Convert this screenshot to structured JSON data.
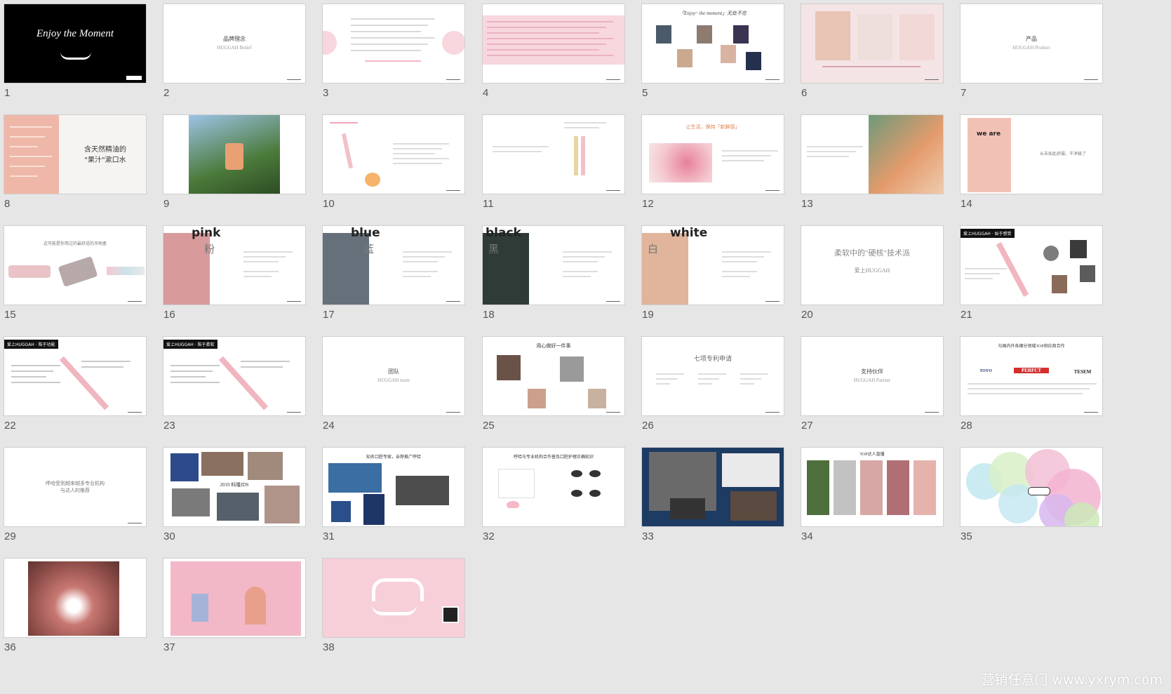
{
  "slides": [
    {
      "num": "1",
      "kind": "cover",
      "title": "Enjoy the Moment"
    },
    {
      "num": "2",
      "kind": "section",
      "title": "品牌理念",
      "subtitle": "HUGGAH Belief"
    },
    {
      "num": "3",
      "kind": "text-pink-circles"
    },
    {
      "num": "4",
      "kind": "text-pink-band"
    },
    {
      "num": "5",
      "kind": "photos-grid",
      "title": "「Enjoy~ the moment」无处不在"
    },
    {
      "num": "6",
      "kind": "photo-woman"
    },
    {
      "num": "7",
      "kind": "section",
      "title": "产品",
      "subtitle": "HUGGAH Product"
    },
    {
      "num": "8",
      "kind": "mouthwash",
      "title": "含天然精油的\n\"果汁\"漱口水"
    },
    {
      "num": "9",
      "kind": "photo-bottle"
    },
    {
      "num": "10",
      "kind": "product-detail"
    },
    {
      "num": "11",
      "kind": "product-detail-2"
    },
    {
      "num": "12",
      "kind": "flowers",
      "title": "让生活，保持「新鲜感」"
    },
    {
      "num": "13",
      "kind": "photo-right"
    },
    {
      "num": "14",
      "kind": "we-are",
      "title": "we are",
      "subtitle": "从未如此舒服，干净极了"
    },
    {
      "num": "15",
      "kind": "cases",
      "title": "这可能是你用过的最舒适的牙刷盒"
    },
    {
      "num": "16",
      "kind": "color",
      "word": "pink",
      "cn": "粉"
    },
    {
      "num": "17",
      "kind": "color",
      "word": "blue",
      "cn": "蓝"
    },
    {
      "num": "18",
      "kind": "color",
      "word": "black",
      "cn": "黑"
    },
    {
      "num": "19",
      "kind": "color",
      "word": "white",
      "cn": "白"
    },
    {
      "num": "20",
      "kind": "tech",
      "title": "柔软中的\"硬核\"技术派",
      "subtitle": "爱上HUGGAH"
    },
    {
      "num": "21",
      "kind": "designers",
      "tag": "爱上HUGGAH · 始于感受"
    },
    {
      "num": "22",
      "kind": "brush-feature",
      "tag": "爱上HUGGAH · 陷于功能"
    },
    {
      "num": "23",
      "kind": "brush-feature2",
      "tag": "爱上HUGGAH · 陷于柔软"
    },
    {
      "num": "24",
      "kind": "section",
      "title": "团队",
      "subtitle": "HUGGAH team"
    },
    {
      "num": "25",
      "kind": "team",
      "title": "用心做好一件事"
    },
    {
      "num": "26",
      "kind": "patents",
      "title": "七项专利申请"
    },
    {
      "num": "27",
      "kind": "section",
      "title": "支持伙伴",
      "subtitle": "HUGGAH Partner"
    },
    {
      "num": "28",
      "kind": "partners",
      "title": "与国内外各细分领域TOP供应商合作",
      "logos": [
        "TOYO",
        "PERFCT",
        "TESEM"
      ]
    },
    {
      "num": "29",
      "kind": "section2",
      "title": "呼哈受到越来越多专业机构\n与达人的推荐"
    },
    {
      "num": "30",
      "kind": "collage",
      "label": "2019 科隆IDS"
    },
    {
      "num": "31",
      "kind": "media",
      "title": "知名口腔专家，亲荐推广呼哈"
    },
    {
      "num": "32",
      "kind": "tips",
      "title": "呼哈与专业机构合作普及口腔护理正确知识"
    },
    {
      "num": "33",
      "kind": "navy-collage"
    },
    {
      "num": "34",
      "kind": "kols",
      "title": "TOP达人直播"
    },
    {
      "num": "35",
      "kind": "circles"
    },
    {
      "num": "36",
      "kind": "smile"
    },
    {
      "num": "37",
      "kind": "pink-scene"
    },
    {
      "num": "38",
      "kind": "end-pink"
    }
  ],
  "watermark": "营销任意门 www.yxrym.com",
  "colors": {
    "background": "#e6e6e6",
    "pink": "#f6cfd8",
    "navy": "#1d3b63"
  }
}
